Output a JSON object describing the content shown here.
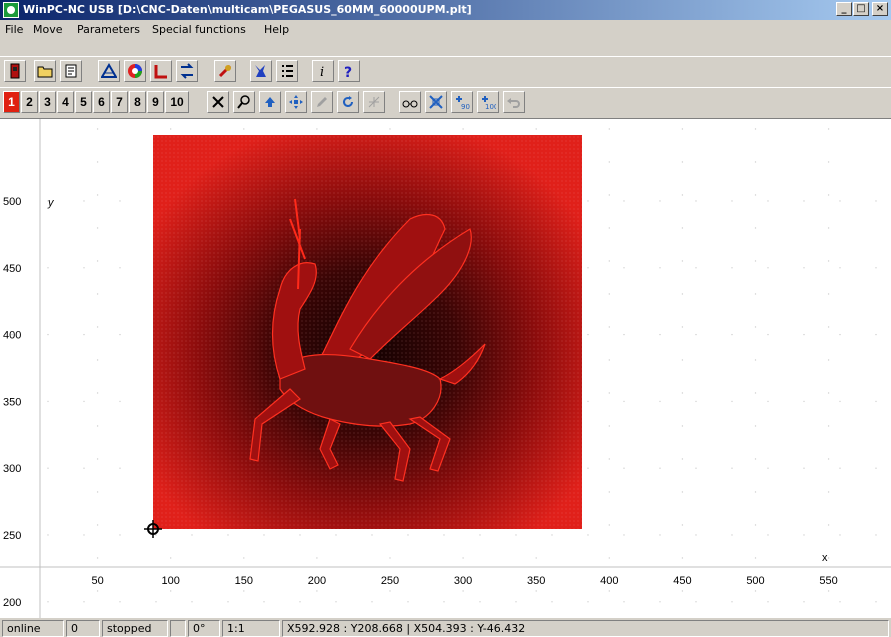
{
  "window": {
    "title": "WinPC-NC USB [D:\\CNC-Daten\\multicam\\PEGASUS_60MM_60000UPM.plt]",
    "minimize": "_",
    "maximize": "□",
    "close": "×"
  },
  "menu": [
    "File",
    "Move",
    "Parameters",
    "Special functions",
    "Help"
  ],
  "tool_layers": [
    "1",
    "2",
    "3",
    "4",
    "5",
    "6",
    "7",
    "8",
    "9",
    "10"
  ],
  "active_layer": "1",
  "icons": {
    "row1": [
      "exit-icon",
      "open-folder-icon",
      "page-icon",
      "workpiece-icon",
      "color-wheel-icon",
      "reference-icon",
      "axis-move-icon",
      "manual-move-icon",
      "tool-icon",
      "list-icon",
      "info-icon",
      "help-icon"
    ],
    "row2": [
      "cancel-icon",
      "zoom-icon",
      "up-icon",
      "pan-icon",
      "pen-icon",
      "rotate-icon",
      "mirror-icon",
      "glasses-icon",
      "fit-icon",
      "rotate-90-icon",
      "rotate-100-icon",
      "undo-icon"
    ]
  },
  "plot": {
    "x_axis_label": "x",
    "y_axis_label": "y",
    "x_ticks": [
      50,
      100,
      150,
      200,
      250,
      300,
      350,
      400,
      450,
      500,
      550
    ],
    "y_ticks": [
      500,
      450,
      400,
      350,
      300,
      250,
      200
    ],
    "workpiece_color": "#e0201a",
    "grid_color": "#d0d0d0"
  },
  "status": {
    "connection": "online",
    "count": "0",
    "state": "stopped",
    "angle": "0°",
    "scale": "1:1",
    "coordinates": "X592.928 : Y208.668  |  X504.393 : Y-46.432"
  }
}
